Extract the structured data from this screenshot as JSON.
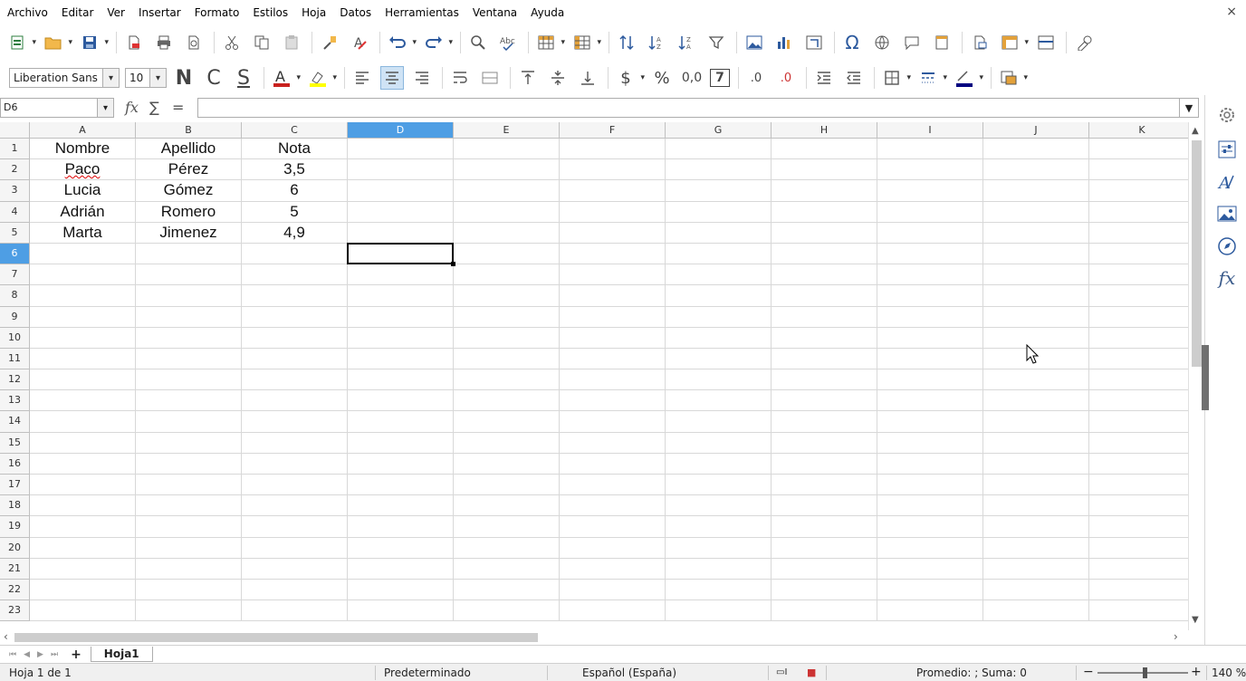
{
  "menu": [
    {
      "label": "Archivo",
      "name": "menu-archivo"
    },
    {
      "label": "Editar",
      "name": "menu-editar"
    },
    {
      "label": "Ver",
      "name": "menu-ver"
    },
    {
      "label": "Insertar",
      "name": "menu-insertar"
    },
    {
      "label": "Formato",
      "name": "menu-formato"
    },
    {
      "label": "Estilos",
      "name": "menu-estilos"
    },
    {
      "label": "Hoja",
      "name": "menu-hoja"
    },
    {
      "label": "Datos",
      "name": "menu-datos"
    },
    {
      "label": "Herramientas",
      "name": "menu-herramientas"
    },
    {
      "label": "Ventana",
      "name": "menu-ventana"
    },
    {
      "label": "Ayuda",
      "name": "menu-ayuda"
    }
  ],
  "close_label": "×",
  "format_toolbar": {
    "font_name": "Liberation Sans",
    "font_size": "10",
    "bold": "N",
    "italic": "C",
    "underline": "S",
    "currency": "$",
    "percent": "%",
    "number": "0,0",
    "date": "7",
    "add_decimal": ".0",
    "del_decimal": ".0"
  },
  "formula_bar": {
    "cell_ref": "D6",
    "fx": "fx",
    "sum": "∑",
    "equals": "=",
    "formula": ""
  },
  "columns": [
    "A",
    "B",
    "C",
    "D",
    "E",
    "F",
    "G",
    "H",
    "I",
    "J",
    "K"
  ],
  "rows": [
    "1",
    "2",
    "3",
    "4",
    "5",
    "6",
    "7",
    "8",
    "9",
    "10",
    "11",
    "12",
    "13",
    "14",
    "15",
    "16",
    "17",
    "18",
    "19",
    "20",
    "21",
    "22",
    "23"
  ],
  "selected_cell": {
    "col": "D",
    "row": "6"
  },
  "cells": [
    [
      "Nombre",
      "Apellido",
      "Nota"
    ],
    [
      "Paco",
      "Pérez",
      "3,5"
    ],
    [
      "Lucia",
      "Gómez",
      "6"
    ],
    [
      "Adrián",
      "Romero",
      "5"
    ],
    [
      "Marta",
      "Jimenez",
      "4,9"
    ]
  ],
  "sheet_tab": "Hoja1",
  "status": {
    "sheet_count": "Hoja 1 de 1",
    "page_style": "Predeterminado",
    "language": "Español (España)",
    "summary": "Promedio: ; Suma: 0",
    "zoom": "140 %"
  },
  "zoom_minus": "−",
  "zoom_plus": "+"
}
